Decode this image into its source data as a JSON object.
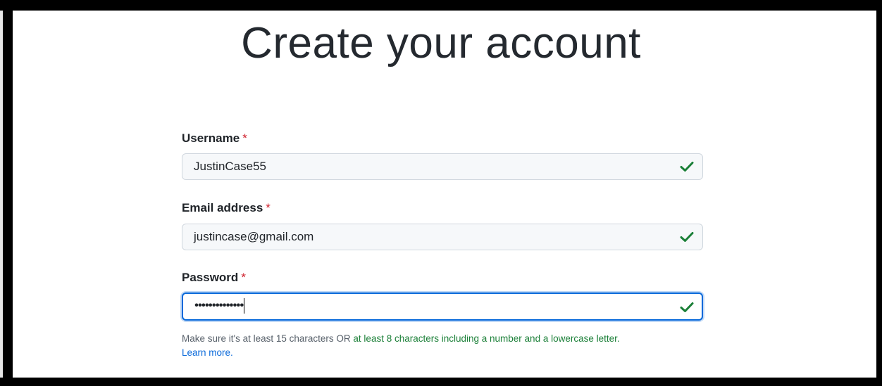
{
  "page": {
    "title": "Create your account"
  },
  "form": {
    "username": {
      "label": "Username",
      "required_mark": "*",
      "value": "JustinCase55",
      "valid": true
    },
    "email": {
      "label": "Email address",
      "required_mark": "*",
      "value": "justincase@gmail.com",
      "valid": true
    },
    "password": {
      "label": "Password",
      "required_mark": "*",
      "value": "••••••••••••••",
      "valid": true,
      "focused": true
    },
    "password_hint": {
      "prefix": "Make sure it's at least 15 characters OR ",
      "highlight": "at least 8 characters including a number and a lowercase letter",
      "suffix": ".",
      "link": "Learn more",
      "link_suffix": "."
    }
  },
  "colors": {
    "valid_check": "#1a7f37",
    "required": "#cf222e",
    "focus_border": "#0969da",
    "hint_green": "#1a7f37",
    "link": "#0969da"
  },
  "icons": {
    "valid": "checkmark-icon"
  }
}
